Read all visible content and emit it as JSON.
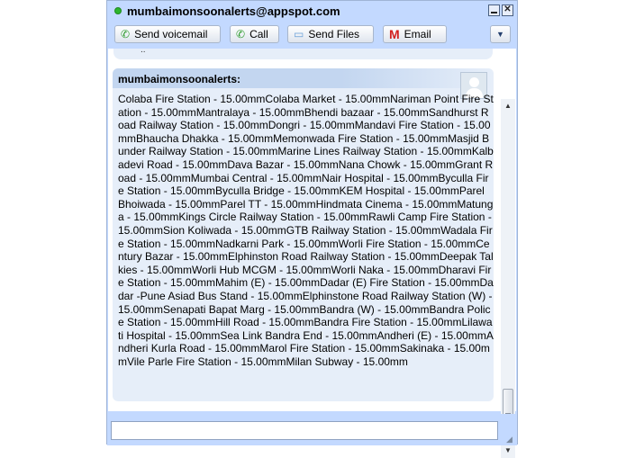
{
  "window": {
    "title": "mumbaimonsoonalerts@appspot.com",
    "minimize_label": "",
    "close_label": "✕"
  },
  "toolbar": {
    "voicemail_label": "Send voicemail",
    "call_label": "Call",
    "files_label": "Send Files",
    "email_label": "Email",
    "menu_label": "▼"
  },
  "icons": {
    "voicemail_icon": "phone-icon",
    "call_icon": "phone-icon",
    "files_icon": "files-icon",
    "email_icon": "gmail-icon",
    "menu_icon": "chevron-down-icon"
  },
  "chat": {
    "previous_fragment": "..",
    "sender": "mumbaimonsoonalerts:",
    "message": "Colaba Fire Station - 15.00mmColaba Market - 15.00mmNariman Point Fire Station - 15.00mmMantralaya - 15.00mmBhendi bazaar - 15.00mmSandhurst Road Railway Station - 15.00mmDongri - 15.00mmMandavi Fire Station - 15.00mmBhaucha Dhakka - 15.00mmMemonwada Fire Station - 15.00mmMasjid Bunder Railway Station - 15.00mmMarine Lines Railway Station - 15.00mmKalbadevi Road - 15.00mmDava Bazar - 15.00mmNana Chowk - 15.00mmGrant Road - 15.00mmMumbai Central - 15.00mmNair Hospital - 15.00mmByculla Fire Station - 15.00mmByculla Bridge - 15.00mmKEM Hospital - 15.00mmParel Bhoiwada - 15.00mmParel TT - 15.00mmHindmata Cinema - 15.00mmMatunga - 15.00mmKings Circle Railway Station - 15.00mmRawli Camp Fire Station - 15.00mmSion Koliwada - 15.00mmGTB Railway Station - 15.00mmWadala Fire Station - 15.00mmNadkarni Park - 15.00mmWorli Fire Station - 15.00mmCentury Bazar - 15.00mmElphinston Road Railway Station - 15.00mmDeepak Talkies - 15.00mmWorli Hub MCGM - 15.00mmWorli Naka - 15.00mmDharavi Fire Station - 15.00mmMahim (E) - 15.00mmDadar (E) Fire Station - 15.00mmDadar -Pune Asiad Bus Stand - 15.00mmElphinstone Road Railway Station (W) - 15.00mmSenapati Bapat Marg - 15.00mmBandra (W) - 15.00mmBandra Police Station - 15.00mmHill Road - 15.00mmBandra Fire Station - 15.00mmLilawati Hospital - 15.00mmSea Link Bandra End - 15.00mmAndheri (E) - 15.00mmAndheri Kurla Road - 15.00mmMarol Fire Station - 15.00mmSakinaka - 15.00mmVile Parle Fire Station - 15.00mmMilan Subway - 15.00mm"
  },
  "input": {
    "value": "",
    "placeholder": ""
  },
  "colors": {
    "frame": "#c3d9ff",
    "bubble": "#e6eef9",
    "status_online": "#2db52d"
  }
}
